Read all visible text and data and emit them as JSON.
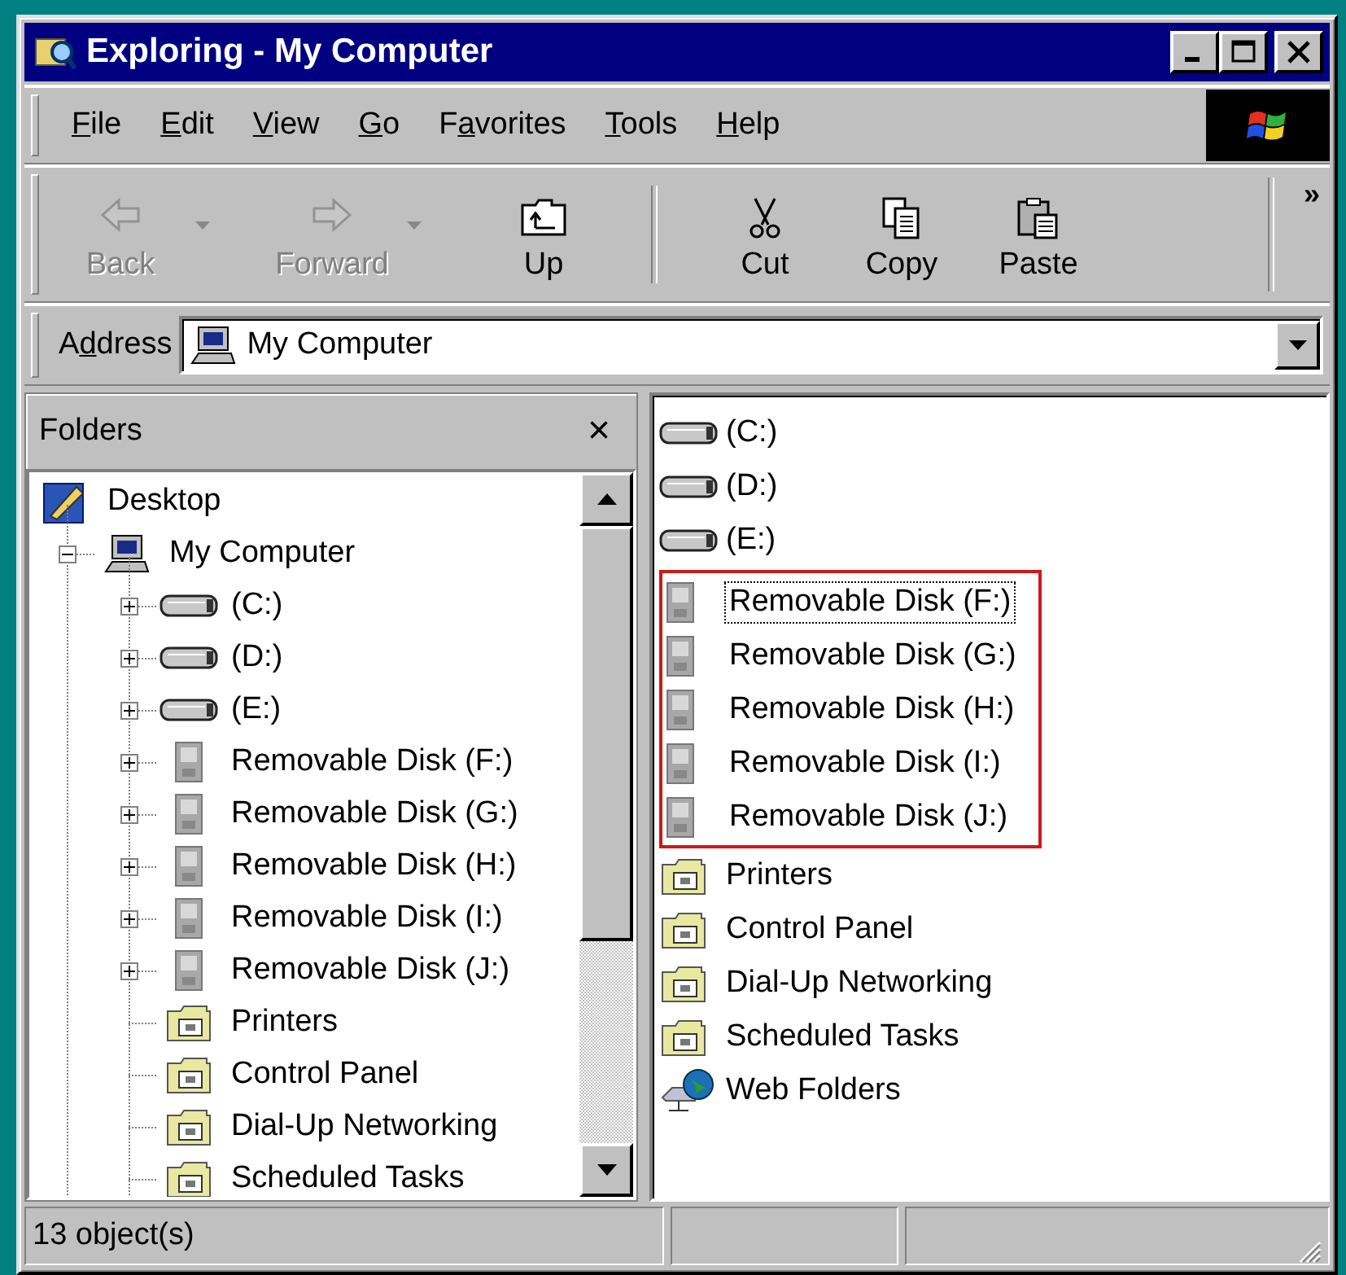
{
  "window": {
    "title": "Exploring - My Computer"
  },
  "menu": [
    {
      "key": "F",
      "post": "ile"
    },
    {
      "key": "E",
      "post": "dit"
    },
    {
      "key": "V",
      "post": "iew"
    },
    {
      "key": "G",
      "post": "o"
    },
    {
      "pre": "F",
      "key": "a",
      "post": "vorites"
    },
    {
      "key": "T",
      "post": "ools"
    },
    {
      "key": "H",
      "post": "elp"
    }
  ],
  "toolbar": {
    "buttons": [
      {
        "kind": "back",
        "label": "Back",
        "disabled": true,
        "dropdown": true
      },
      {
        "kind": "forward",
        "label": "Forward",
        "disabled": true,
        "dropdown": true
      },
      {
        "kind": "up",
        "label": "Up",
        "disabled": false,
        "dropdown": false
      },
      {
        "kind": "separator"
      },
      {
        "kind": "cut",
        "label": "Cut",
        "disabled": false,
        "dropdown": false
      },
      {
        "kind": "copy",
        "label": "Copy",
        "disabled": false,
        "dropdown": false
      },
      {
        "kind": "paste",
        "label": "Paste",
        "disabled": false,
        "dropdown": false
      }
    ],
    "overflow": "»"
  },
  "address": {
    "label": {
      "pre": "A",
      "key": "d",
      "post": "dress"
    },
    "value": "My Computer"
  },
  "folders_pane": {
    "title": "Folders",
    "close": "×",
    "tree": [
      {
        "label": "Desktop",
        "kind": "desktop",
        "children": [
          {
            "label": "My Computer",
            "kind": "computer",
            "expanded": true,
            "children": [
              {
                "label": "(C:)",
                "kind": "drive",
                "expanded": false
              },
              {
                "label": "(D:)",
                "kind": "drive",
                "expanded": false
              },
              {
                "label": "(E:)",
                "kind": "drive",
                "expanded": false
              },
              {
                "label": "Removable Disk (F:)",
                "kind": "removable",
                "expanded": false
              },
              {
                "label": "Removable Disk (G:)",
                "kind": "removable",
                "expanded": false
              },
              {
                "label": "Removable Disk (H:)",
                "kind": "removable",
                "expanded": false
              },
              {
                "label": "Removable Disk (I:)",
                "kind": "removable",
                "expanded": false
              },
              {
                "label": "Removable Disk (J:)",
                "kind": "removable",
                "expanded": false
              },
              {
                "label": "Printers",
                "kind": "folder"
              },
              {
                "label": "Control Panel",
                "kind": "folder"
              },
              {
                "label": "Dial-Up Networking",
                "kind": "folder"
              },
              {
                "label": "Scheduled Tasks",
                "kind": "folder"
              }
            ]
          }
        ]
      }
    ]
  },
  "contents": [
    {
      "highlighted": false,
      "items": [
        {
          "label": "(C:)",
          "kind": "drive",
          "focused": false
        },
        {
          "label": "(D:)",
          "kind": "drive",
          "focused": false
        },
        {
          "label": "(E:)",
          "kind": "drive",
          "focused": false
        }
      ]
    },
    {
      "highlighted": true,
      "items": [
        {
          "label": "Removable Disk (F:)",
          "kind": "removable",
          "focused": true
        },
        {
          "label": "Removable Disk (G:)",
          "kind": "removable",
          "focused": false
        },
        {
          "label": "Removable Disk (H:)",
          "kind": "removable",
          "focused": false
        },
        {
          "label": "Removable Disk (I:)",
          "kind": "removable",
          "focused": false
        },
        {
          "label": "Removable Disk (J:)",
          "kind": "removable",
          "focused": false
        }
      ]
    },
    {
      "highlighted": false,
      "items": [
        {
          "label": "Printers",
          "kind": "folder",
          "focused": false
        },
        {
          "label": "Control Panel",
          "kind": "folder",
          "focused": false
        },
        {
          "label": "Dial-Up Networking",
          "kind": "folder",
          "focused": false
        },
        {
          "label": "Scheduled Tasks",
          "kind": "folder",
          "focused": false
        },
        {
          "label": "Web Folders",
          "kind": "web",
          "focused": false
        }
      ]
    }
  ],
  "status_bar": {
    "text": "13 object(s)"
  }
}
